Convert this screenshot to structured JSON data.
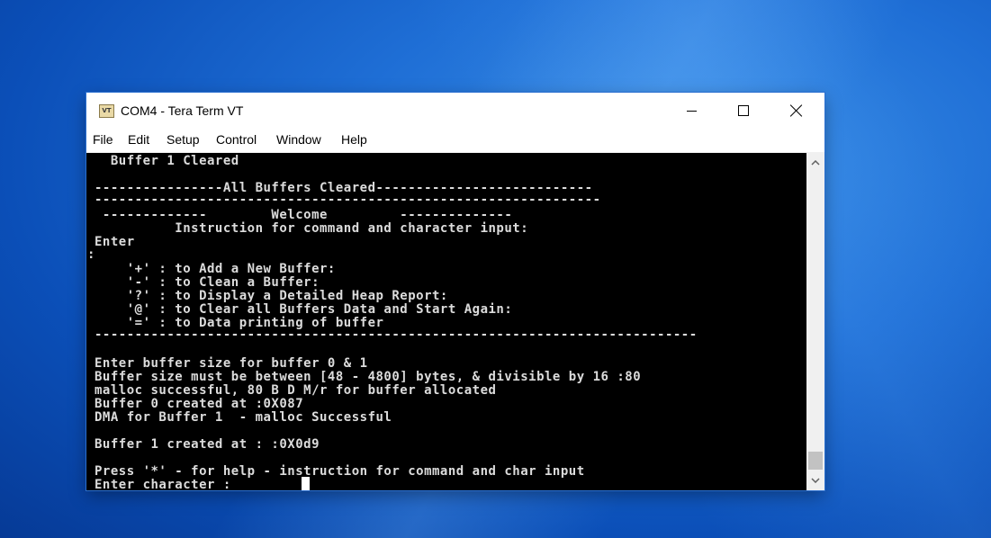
{
  "window": {
    "title": "COM4 - Tera Term VT",
    "icon_label": "VT",
    "icon": "teraterm-vt-icon"
  },
  "controls": {
    "minimize_icon": "minimize-icon",
    "maximize_icon": "maximize-icon",
    "close_icon": "close-icon"
  },
  "menu": {
    "items": [
      "File",
      "Edit",
      "Setup",
      "Control",
      "Window",
      "Help"
    ]
  },
  "terminal": {
    "text_color": "#dcdcdc",
    "background": "#000000",
    "lines": [
      "  Buffer 1 Cleared",
      "",
      "----------------All Buffers Cleared---------------------------",
      "---------------------------------------------------------------",
      " -------------        Welcome         --------------",
      "          Instruction for command and character input:",
      "Enter",
      ":",
      "    '+' : to Add a New Buffer:",
      "    '-' : to Clean a Buffer:",
      "    '?' : to Display a Detailed Heap Report:",
      "    '@' : to Clear all Buffers Data and Start Again:",
      "    '=' : to Data printing of buffer",
      "---------------------------------------------------------------------------",
      "",
      "Enter buffer size for buffer 0 & 1",
      "Buffer size must be between [48 - 4800] bytes, & divisible by 16 :80",
      "malloc successful, 80 B D M/r for buffer allocated",
      "Buffer 0 created at :0X087",
      "DMA for Buffer 1  - malloc Successful",
      "",
      "Buffer 1 created at : :0X0d9",
      "",
      "Press '*' - for help - instruction for command and char input",
      "Enter character :"
    ]
  },
  "scrollbar": {
    "up_icon": "scroll-up-arrow-icon",
    "down_icon": "scroll-down-arrow-icon"
  }
}
